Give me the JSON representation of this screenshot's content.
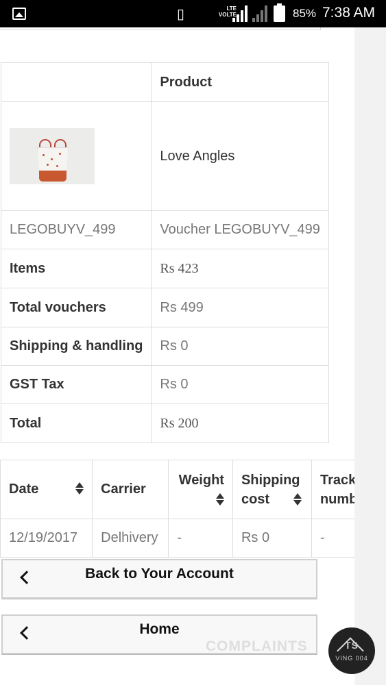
{
  "status_bar": {
    "vibrate_icon": "vibrate-icon",
    "network": "LTE",
    "volte": "VOLTE",
    "battery": "85%",
    "time": "7:38 AM"
  },
  "detail_table": {
    "header": {
      "product": "Product"
    },
    "product": {
      "name": "Love Angles",
      "image_icon": "tote-bag-image"
    },
    "voucher": {
      "code": "LEGOBUYV_499",
      "name": "Voucher LEGOBUYV_499"
    },
    "summary": [
      {
        "label": "Items",
        "value": "Rs 423"
      },
      {
        "label": "Total vouchers",
        "value": "Rs 499"
      },
      {
        "label": "Shipping & handling",
        "value": "Rs 0"
      },
      {
        "label": "GST Tax",
        "value": "Rs 0"
      },
      {
        "label": "Total",
        "value": "Rs 200"
      }
    ]
  },
  "shipping_table": {
    "headers": {
      "date": "Date",
      "carrier": "Carrier",
      "weight": "Weight",
      "cost": "Shipping cost",
      "tracking": "Tracking number"
    },
    "rows": [
      {
        "date": "12/19/2017",
        "carrier": "Delhivery",
        "weight": "-",
        "cost": "Rs 0",
        "tracking": "-"
      }
    ]
  },
  "buttons": {
    "back": "Back to Your Account",
    "home": "Home"
  },
  "watermark": {
    "text": "COMPLAINTS",
    "badge": "TS",
    "badge_sub": "VING 004"
  }
}
